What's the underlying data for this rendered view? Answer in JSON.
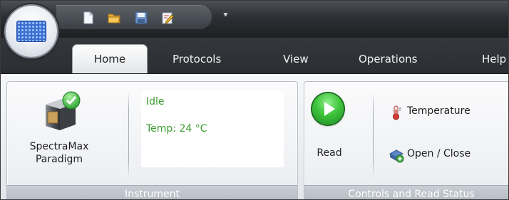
{
  "tabs": [
    "Home",
    "Protocols",
    "View",
    "Operations",
    "Help"
  ],
  "quick_access": {
    "icons": [
      "new-document-icon",
      "open-folder-icon",
      "save-icon",
      "edit-protocol-icon",
      "customize-dropdown-icon"
    ]
  },
  "instrument_group": {
    "instrument_name": "SpectraMax",
    "instrument_model": "Paradigm",
    "status": "Idle",
    "temperature": "Temp: 24 °C",
    "group_label": "Instrument"
  },
  "controls_group": {
    "read_label": "Read",
    "temperature_label": "Temperature",
    "open_close_label": "Open / Close",
    "group_label": "Controls and Read Status"
  },
  "colors": {
    "status_green": "#3a9c2f",
    "tab_strip": "#2b2e32",
    "group_label_bg": "#b4bac3"
  }
}
